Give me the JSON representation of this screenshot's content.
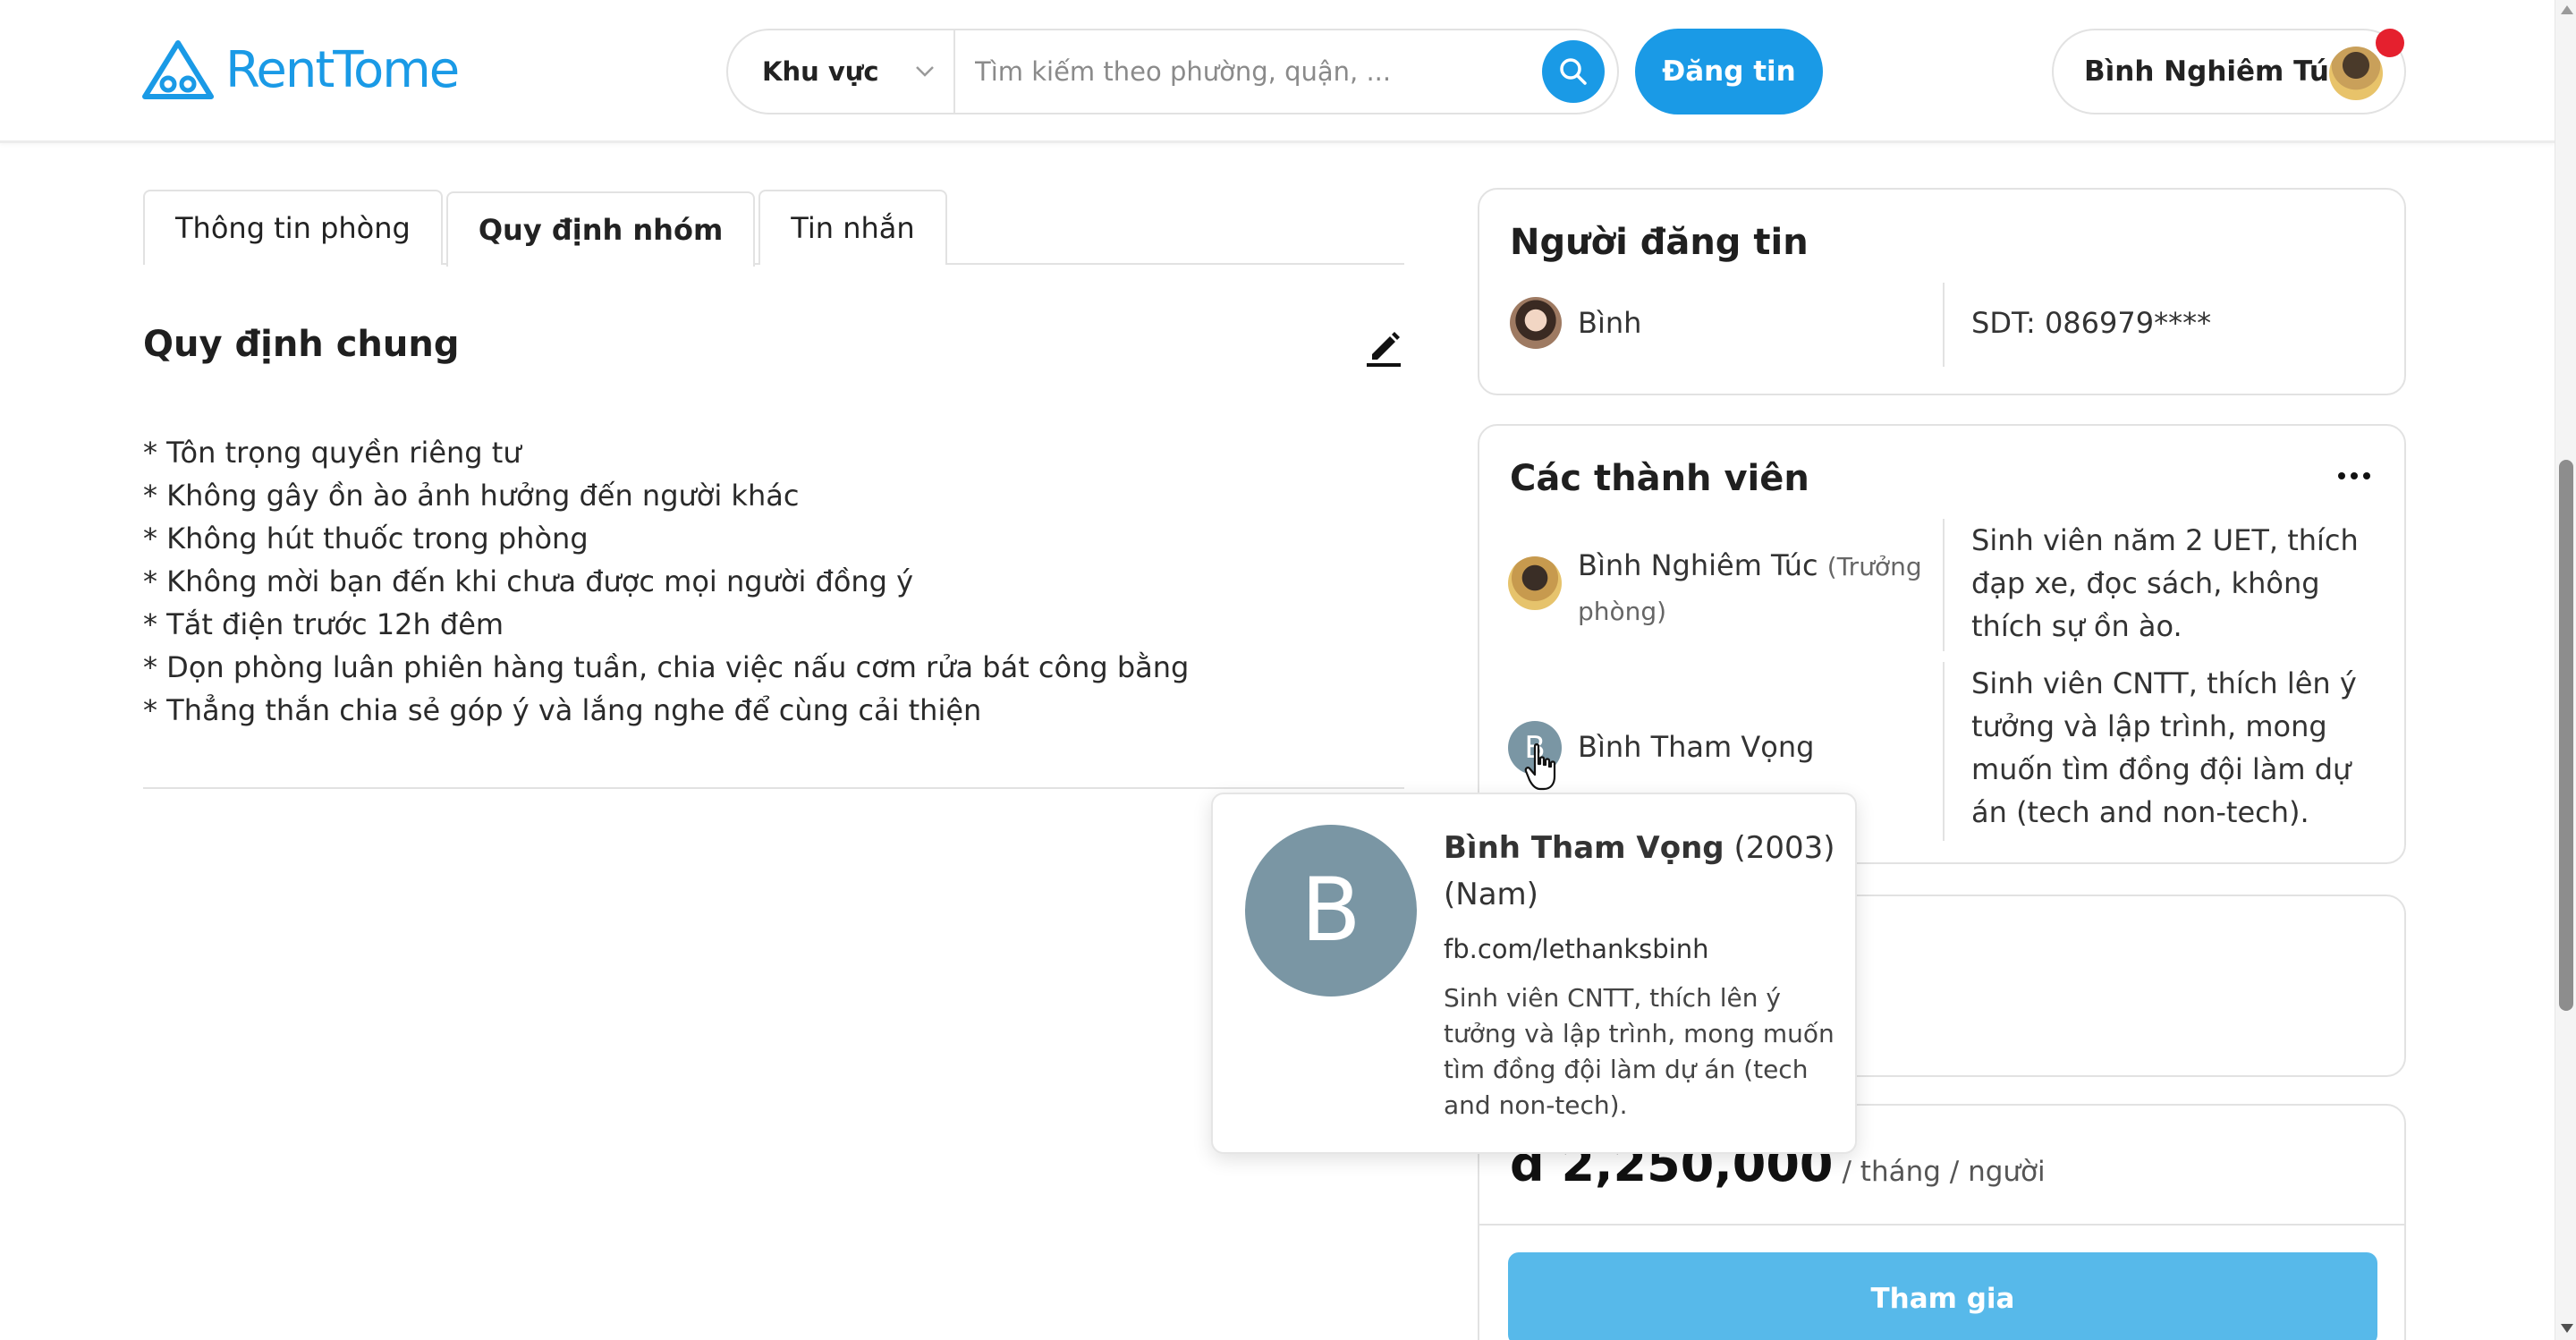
{
  "header": {
    "logo_text": "RentTome",
    "region_label": "Khu vực",
    "search_placeholder": "Tìm kiếm theo phường, quận, ...",
    "post_button": "Đăng tin",
    "user_name": "Bình Nghiêm Túc",
    "brand_color": "#1a9ae6",
    "notification_color": "#e5202e"
  },
  "tabs": [
    {
      "label": "Thông tin phòng",
      "active": false
    },
    {
      "label": "Quy định nhóm",
      "active": true
    },
    {
      "label": "Tin nhắn",
      "active": false
    }
  ],
  "rules": {
    "title": "Quy định chung",
    "items": [
      "* Tôn trọng quyền riêng tư",
      "* Không gây ồn ào ảnh hưởng đến người khác",
      "* Không hút thuốc trong phòng",
      "* Không mời bạn đến khi chưa được mọi người đồng ý",
      "* Tắt điện trước 12h đêm",
      "* Dọn phòng luân phiên hàng tuần, chia việc nấu cơm rửa bát công bằng",
      "* Thẳng thắn chia sẻ góp ý và lắng nghe để cùng cải thiện"
    ]
  },
  "poster": {
    "title": "Người đăng tin",
    "name": "Bình",
    "phone": "SDT: 086979****"
  },
  "members": {
    "title": "Các thành viên",
    "list": [
      {
        "name": "Bình Nghiêm Túc",
        "role": "(Trưởng phòng)",
        "bio": "Sinh viên năm 2 UET, thích đạp xe, đọc sách, không thích sự ồn ào."
      },
      {
        "name": "Bình Tham Vọng",
        "initial": "B",
        "bio": "Sinh viên CNTT, thích lên ý tưởng và lập trình, mong muốn tìm đồng đội làm dự án (tech and non-tech)."
      }
    ]
  },
  "popover": {
    "initial": "B",
    "name": "Bình Tham Vọng",
    "year": " (2003)",
    "gender": "(Nam)",
    "link": "fb.com/lethanksbinh",
    "bio": "Sinh viên CNTT, thích lên ý tưởng và lập trình, mong muốn tìm đồng đội làm dự án (tech and non-tech)."
  },
  "price": {
    "value": "đ 2,250,000",
    "unit": "/ tháng / người",
    "join_button": "Tham gia",
    "join_color": "#57b9ea"
  }
}
